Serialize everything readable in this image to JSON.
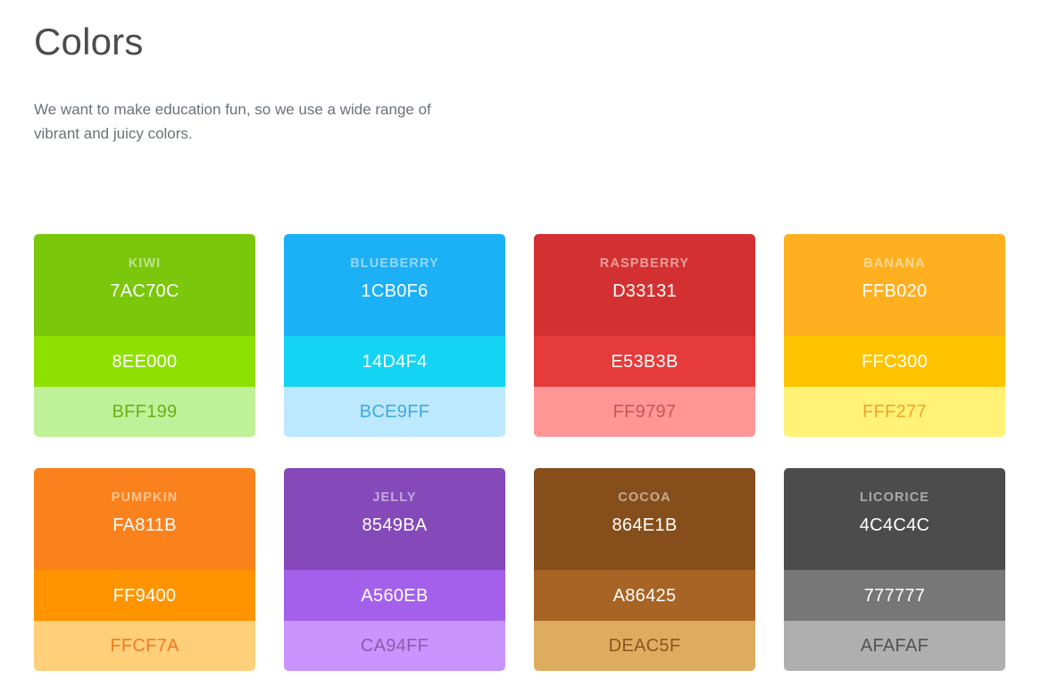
{
  "header": {
    "title": "Colors",
    "description": "We want to make education fun, so we use a wide range of vibrant and juicy colors."
  },
  "palette": {
    "background": "#FFFFFF",
    "title_color": "#4C4C4C",
    "description_color": "#6B7178",
    "name_label_color": "rgba(255,255,255,0.52)",
    "hex_label_color": "#FFFFFF"
  },
  "swatches": [
    {
      "name": "KIWI",
      "main_hex": "7AC70C",
      "main_color": "#7AC70C",
      "mid_hex": "8EE000",
      "mid_color": "#8EE000",
      "light_hex": "BFF199",
      "light_color": "#BFF199",
      "light_text_color": "#6FAF19"
    },
    {
      "name": "BLUEBERRY",
      "main_hex": "1CB0F6",
      "main_color": "#1CB0F6",
      "mid_hex": "14D4F4",
      "mid_color": "#14D4F4",
      "light_hex": "BCE9FF",
      "light_color": "#BCE9FF",
      "light_text_color": "#41A8E0"
    },
    {
      "name": "RASPBERRY",
      "main_hex": "D33131",
      "main_color": "#D33131",
      "mid_hex": "E53B3B",
      "mid_color": "#E53B3B",
      "light_hex": "FF9797",
      "light_color": "#FF9797",
      "light_text_color": "#C85656"
    },
    {
      "name": "BANANA",
      "main_hex": "FFB020",
      "main_color": "#FFB020",
      "mid_hex": "FFC300",
      "mid_color": "#FFC300",
      "light_hex": "FFF277",
      "light_color": "#FFF277",
      "light_text_color": "#F0A42B"
    },
    {
      "name": "PUMPKIN",
      "main_hex": "FA811B",
      "main_color": "#FA811B",
      "mid_hex": "FF9400",
      "mid_color": "#FF9400",
      "light_hex": "FFCF7A",
      "light_color": "#FFCF7A",
      "light_text_color": "#F07C23"
    },
    {
      "name": "JELLY",
      "main_hex": "8549BA",
      "main_color": "#8549BA",
      "mid_hex": "A560EB",
      "mid_color": "#A560EB",
      "light_hex": "CA94FF",
      "light_color": "#CA94FF",
      "light_text_color": "#8D5BAE"
    },
    {
      "name": "COCOA",
      "main_hex": "864E1B",
      "main_color": "#864E1B",
      "mid_hex": "A86425",
      "mid_color": "#A86425",
      "light_hex": "DEAC5F",
      "light_color": "#DEAC5F",
      "light_text_color": "#8A561F"
    },
    {
      "name": "LICORICE",
      "main_hex": "4C4C4C",
      "main_color": "#4C4C4C",
      "mid_hex": "777777",
      "mid_color": "#777777",
      "light_hex": "AFAFAF",
      "light_color": "#AFAFAF",
      "light_text_color": "#525252"
    }
  ]
}
